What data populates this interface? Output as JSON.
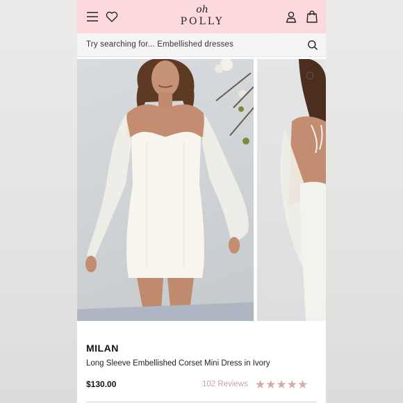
{
  "header": {
    "logo_top": "oh",
    "logo_bottom": "POLLY",
    "background_color": "#fbd9dc",
    "icons": [
      "hamburger-menu-icon",
      "heart-icon",
      "user-icon",
      "shopping-bag-icon"
    ]
  },
  "search": {
    "placeholder": "Try searching for... Embellished dresses",
    "icon": "search-icon"
  },
  "gallery": {
    "image_count_visible": 2
  },
  "product": {
    "brand": "MILAN",
    "name": "Long Sleeve Embellished Corset Mini Dress in Ivory",
    "price": "$130.00",
    "reviews_label": "102 Reviews",
    "rating": 5,
    "star_color": "#d9a8ab"
  }
}
